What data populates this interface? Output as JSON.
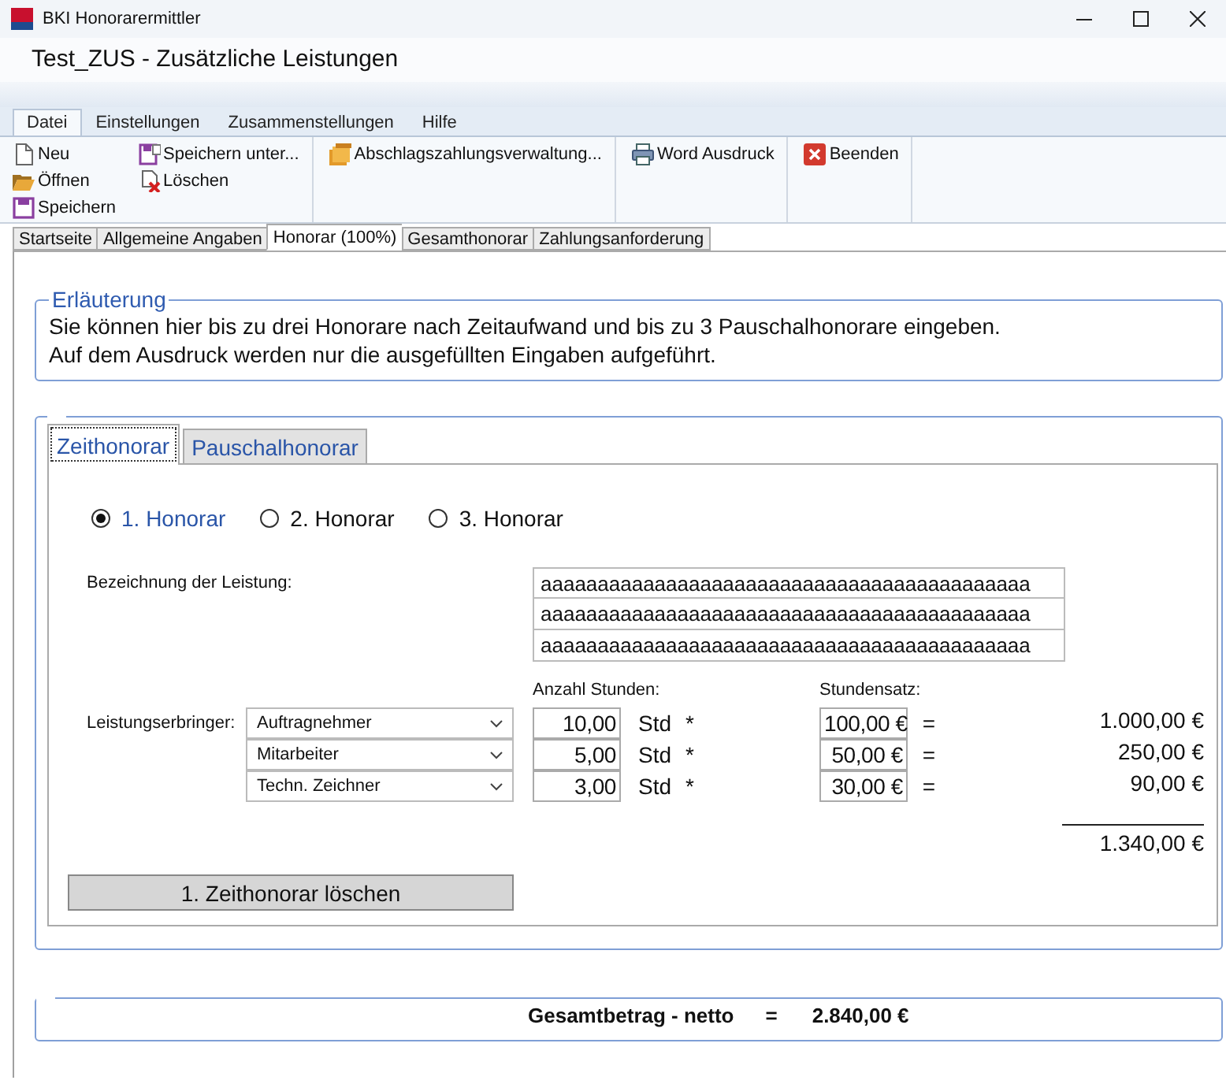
{
  "window": {
    "title": "BKI Honorarermittler"
  },
  "document_title": "Test_ZUS - Zusätzliche Leistungen",
  "ribbon_tabs": [
    {
      "label": "Datei",
      "selected": true
    },
    {
      "label": "Einstellungen",
      "selected": false
    },
    {
      "label": "Zusammenstellungen",
      "selected": false
    },
    {
      "label": "Hilfe",
      "selected": false
    }
  ],
  "ribbon_groups": [
    {
      "columns": [
        [
          "Neu",
          "Öffnen",
          "Speichern"
        ],
        [
          "Speichern unter...",
          "Löschen"
        ]
      ]
    },
    {
      "columns": [
        [
          "Abschlagszahlungsverwaltung..."
        ]
      ]
    },
    {
      "columns": [
        [
          "Word Ausdruck"
        ]
      ]
    },
    {
      "columns": [
        [
          "Beenden"
        ]
      ]
    }
  ],
  "page_tabs": [
    {
      "label": "Startseite",
      "selected": false
    },
    {
      "label": "Allgemeine Angaben",
      "selected": false
    },
    {
      "label": "Honorar (100%)",
      "selected": true
    },
    {
      "label": "Gesamthonorar",
      "selected": false
    },
    {
      "label": "Zahlungsanforderung",
      "selected": false
    }
  ],
  "explanation": {
    "title": "Erläuterung",
    "lines": [
      "Sie können hier bis zu drei Honorare nach Zeitaufwand und bis zu 3 Pauschalhonorare eingeben.",
      "Auf dem Ausdruck werden nur die ausgefüllten Eingaben aufgeführt."
    ]
  },
  "fee_panel": {
    "tabs": [
      {
        "label": "Zeithonorar",
        "selected": true
      },
      {
        "label": "Pauschalhonorar",
        "selected": false
      }
    ],
    "options": [
      {
        "label": "1. Honorar",
        "selected": true
      },
      {
        "label": "2. Honorar",
        "selected": false
      },
      {
        "label": "3. Honorar",
        "selected": false
      }
    ],
    "description_label": "Bezeichnung der Leistung:",
    "description_lines": [
      "aaaaaaaaaaaaaaaaaaaaaaaaaaaaaaaaaaaaaaaaaaa",
      "aaaaaaaaaaaaaaaaaaaaaaaaaaaaaaaaaaaaaaaaaaa",
      "aaaaaaaaaaaaaaaaaaaaaaaaaaaaaaaaaaaaaaaaaaa"
    ],
    "provider_label": "Leistungserbringer:",
    "hours_header": "Anzahl Stunden:",
    "rate_header": "Stundensatz:",
    "rows": [
      {
        "provider": "Auftragnehmer",
        "hours": "10,00",
        "unit": "Std",
        "operator": "*",
        "rate": "100,00 €",
        "equals": "=",
        "amount": "1.000,00 €"
      },
      {
        "provider": "Mitarbeiter",
        "hours": "5,00",
        "unit": "Std",
        "operator": "*",
        "rate": "50,00 €",
        "equals": "=",
        "amount": "250,00 €"
      },
      {
        "provider": "Techn. Zeichner",
        "hours": "3,00",
        "unit": "Std",
        "operator": "*",
        "rate": "30,00 €",
        "equals": "=",
        "amount": "90,00 €"
      }
    ],
    "subtotal": "1.340,00 €",
    "delete_button": "1. Zeithonorar löschen"
  },
  "total": {
    "label": "Gesamtbetrag - netto",
    "equals": "=",
    "value": "2.840,00 €"
  }
}
